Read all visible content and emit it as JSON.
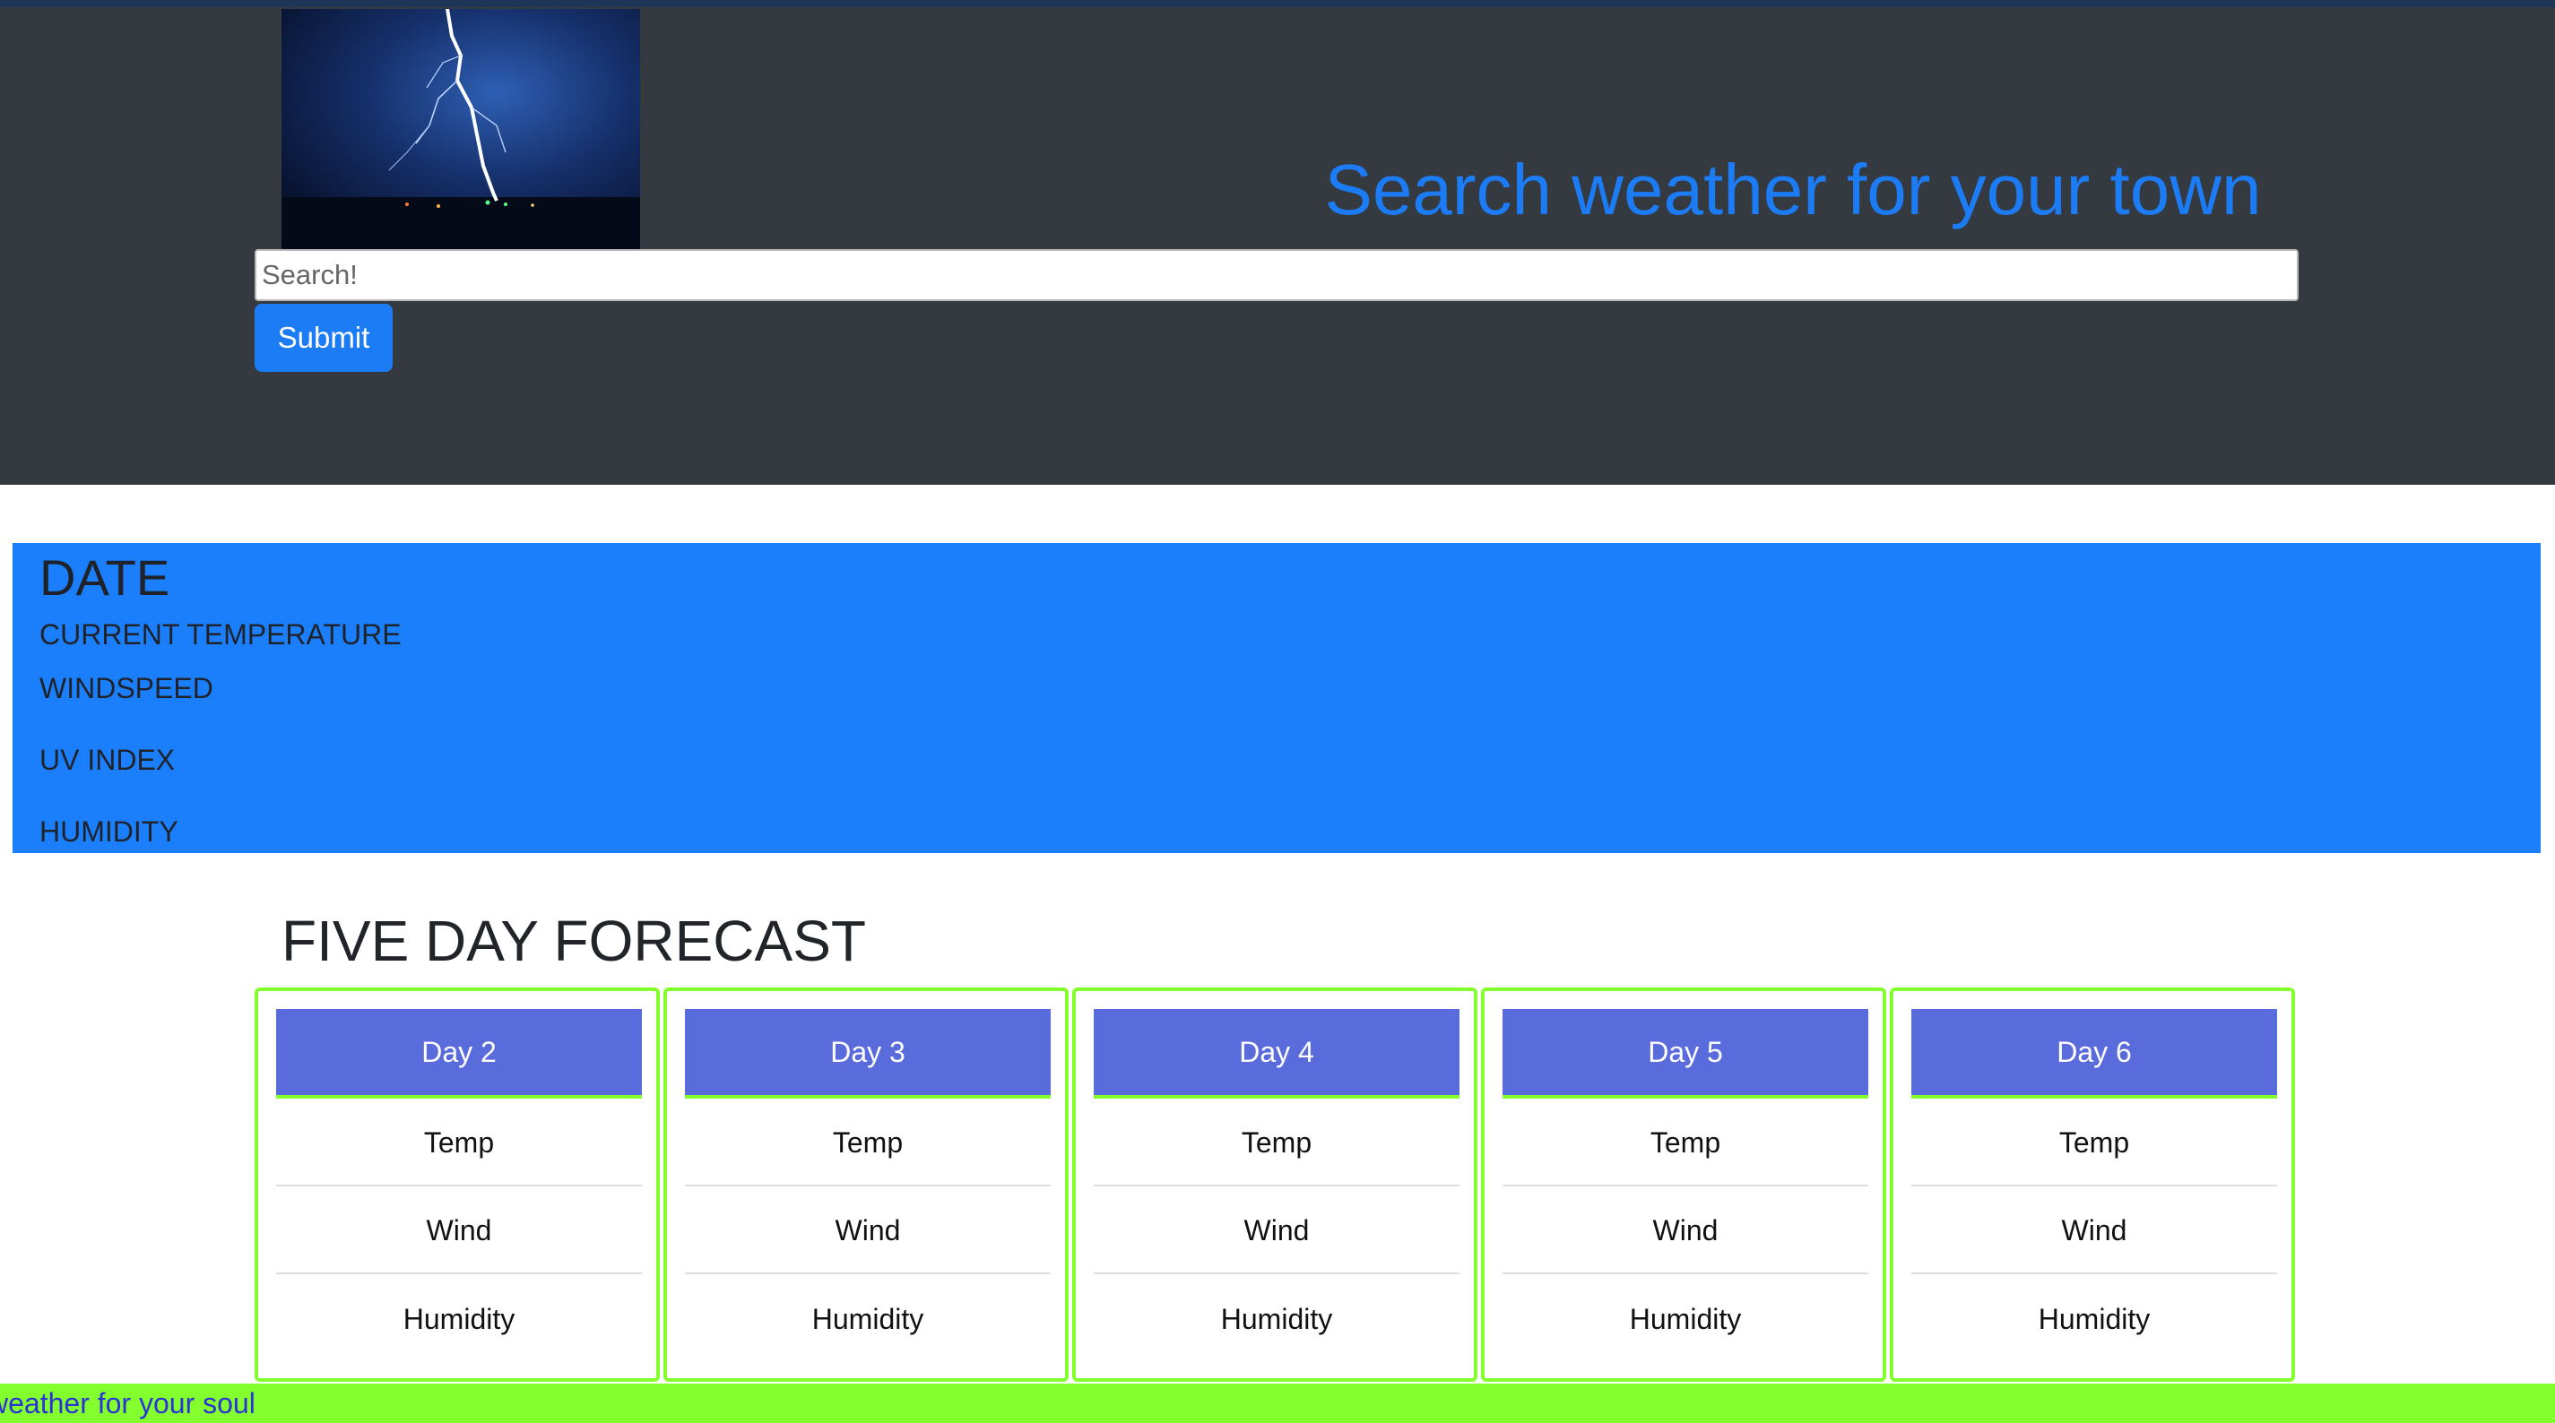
{
  "header": {
    "title": "Search weather for your town",
    "image_alt": "lightning-bolt-photo",
    "search": {
      "placeholder": "Search!",
      "value": ""
    },
    "submit_label": "Submit"
  },
  "current": {
    "date_label": "DATE",
    "temperature_label": "CURRENT TEMPERATURE",
    "windspeed_label": "WINDSPEED",
    "uv_label": "UV INDEX",
    "humidity_label": "HUMIDITY"
  },
  "forecast": {
    "title": "FIVE DAY FORECAST",
    "days": [
      {
        "label": "Day 2",
        "temp": "Temp",
        "wind": "Wind",
        "humidity": "Humidity"
      },
      {
        "label": "Day 3",
        "temp": "Temp",
        "wind": "Wind",
        "humidity": "Humidity"
      },
      {
        "label": "Day 4",
        "temp": "Temp",
        "wind": "Wind",
        "humidity": "Humidity"
      },
      {
        "label": "Day 5",
        "temp": "Temp",
        "wind": "Wind",
        "humidity": "Humidity"
      },
      {
        "label": "Day 6",
        "temp": "Temp",
        "wind": "Wind",
        "humidity": "Humidity"
      }
    ]
  },
  "footer": {
    "text": "weather for your soul"
  },
  "colors": {
    "header_bg": "#343a40",
    "accent_blue": "#1b7cf5",
    "current_bg": "#1b7ffb",
    "card_head": "#5a6bdc",
    "lime": "#84ff2e",
    "footer_text": "#2b33d6"
  }
}
